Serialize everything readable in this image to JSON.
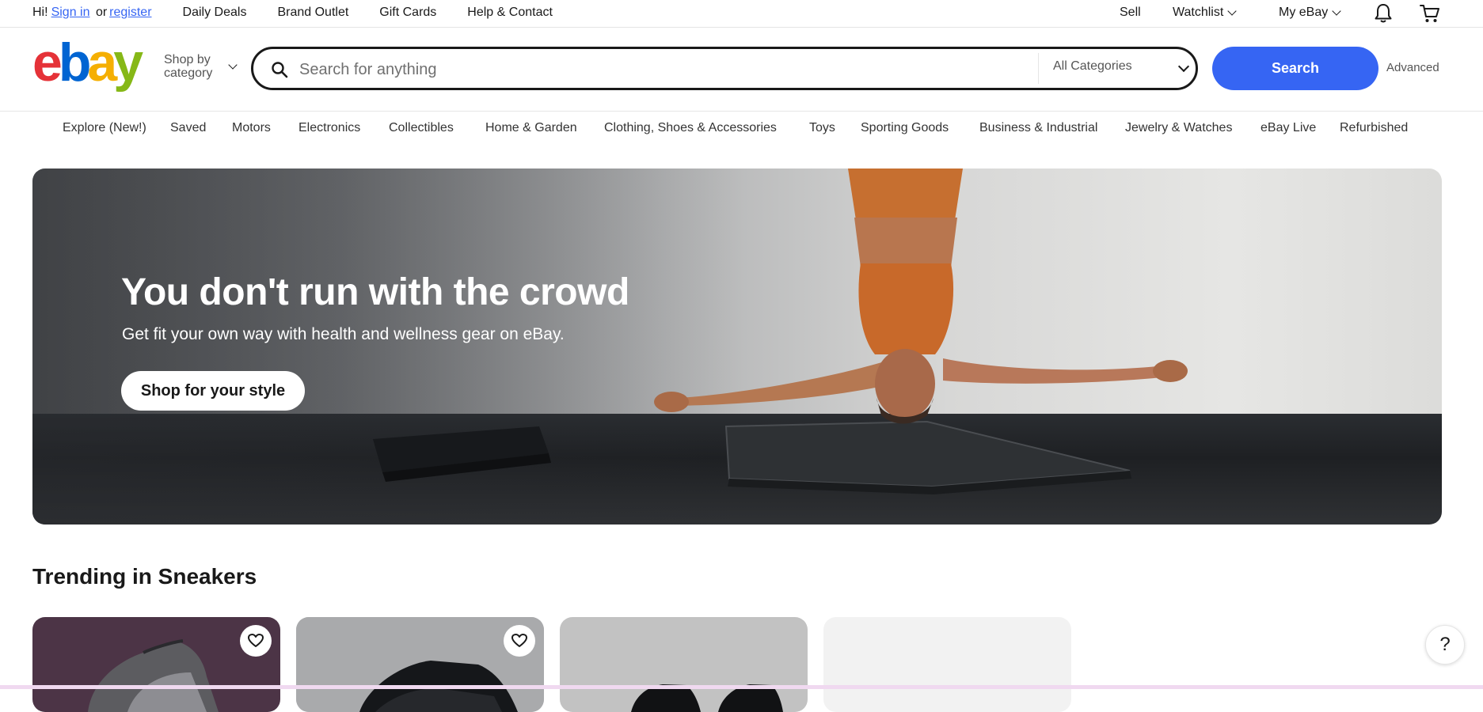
{
  "topbar": {
    "greeting_prefix": "Hi!",
    "sign_in": "Sign in",
    "or_text": "or",
    "register": "register",
    "links": [
      "Daily Deals",
      "Brand Outlet",
      "Gift Cards",
      "Help & Contact"
    ],
    "sell": "Sell",
    "watchlist": "Watchlist",
    "my_ebay": "My eBay"
  },
  "header": {
    "logo_letters": [
      "e",
      "b",
      "a",
      "y"
    ],
    "shop_by_line1": "Shop by",
    "shop_by_line2": "category",
    "search_placeholder": "Search for anything",
    "category_select": "All Categories",
    "search_button": "Search",
    "advanced": "Advanced"
  },
  "nav": {
    "items": [
      "Explore (New!)",
      "Saved",
      "Motors",
      "Electronics",
      "Collectibles",
      "Home & Garden",
      "Clothing, Shoes & Accessories",
      "Toys",
      "Sporting Goods",
      "Business & Industrial",
      "Jewelry & Watches",
      "eBay Live",
      "Refurbished"
    ]
  },
  "hero": {
    "title": "You don't run with the crowd",
    "subtitle": "Get fit your own way with health and wellness gear on eBay.",
    "cta": "Shop for your style"
  },
  "trending": {
    "title": "Trending in Sneakers"
  },
  "help": "?",
  "icons": {
    "bell": "bell-icon",
    "cart": "cart-icon",
    "search": "search-icon",
    "heart": "heart-icon",
    "help": "help-icon"
  },
  "colors": {
    "brand_blue": "#3665f3",
    "logo_red": "#e53238",
    "logo_blue": "#0064d2",
    "logo_yellow": "#f5af02",
    "logo_green": "#86b817"
  }
}
